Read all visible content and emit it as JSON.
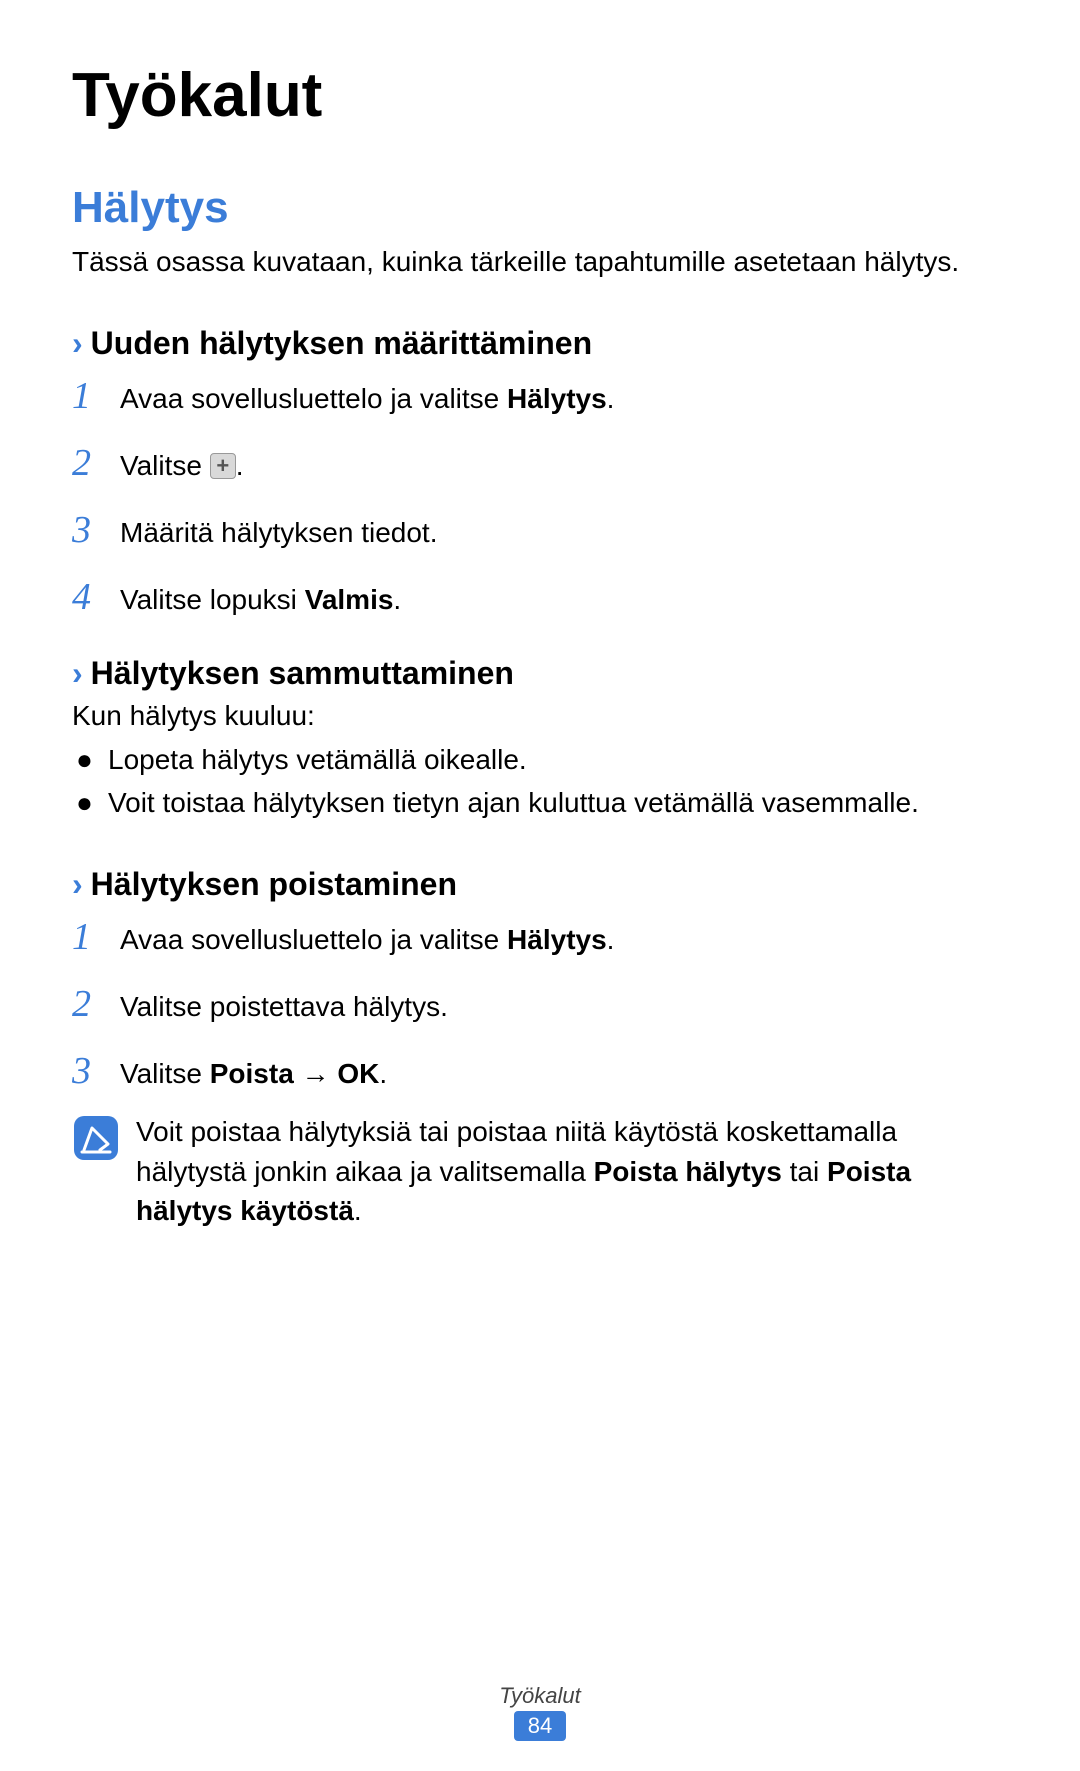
{
  "page": {
    "title": "Työkalut",
    "footer_label": "Työkalut",
    "page_number": "84"
  },
  "section": {
    "title": "Hälytys",
    "intro": "Tässä osassa kuvataan, kuinka tärkeille tapahtumille asetetaan hälytys."
  },
  "sub1": {
    "title": "Uuden hälytyksen määrittäminen",
    "steps": {
      "s1_a": "Avaa sovellusluettelo ja valitse ",
      "s1_b": "Hälytys",
      "s1_c": ".",
      "s2_a": "Valitse ",
      "s2_c": ".",
      "s3": "Määritä hälytyksen tiedot.",
      "s4_a": "Valitse lopuksi ",
      "s4_b": "Valmis",
      "s4_c": "."
    }
  },
  "sub2": {
    "title": "Hälytyksen sammuttaminen",
    "intro": "Kun hälytys kuuluu:",
    "bullets": {
      "b1": "Lopeta hälytys vetämällä       oikealle.",
      "b2": "Voit toistaa hälytyksen tietyn ajan kuluttua vetämällä vasemmalle."
    }
  },
  "sub3": {
    "title": "Hälytyksen poistaminen",
    "steps": {
      "s1_a": "Avaa sovellusluettelo ja valitse ",
      "s1_b": "Hälytys",
      "s1_c": ".",
      "s2": "Valitse poistettava hälytys.",
      "s3_a": "Valitse ",
      "s3_b": "Poista",
      "s3_c": " → ",
      "s3_d": "OK",
      "s3_e": "."
    },
    "note": {
      "t1": "Voit poistaa hälytyksiä tai poistaa niitä käytöstä koskettamalla hälytystä jonkin aikaa ja valitsemalla ",
      "t2": "Poista hälytys",
      "t3": " tai ",
      "t4": "Poista hälytys käytöstä",
      "t5": "."
    }
  },
  "nums": {
    "n1": "1",
    "n2": "2",
    "n3": "3",
    "n4": "4"
  },
  "chevron": "›",
  "bullet": "●"
}
